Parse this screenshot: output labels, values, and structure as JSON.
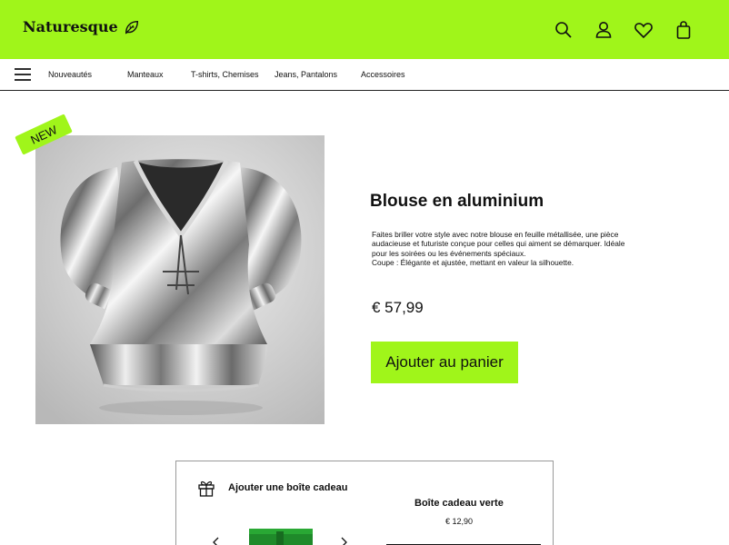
{
  "brand": {
    "name": "Naturesque",
    "logo_icon": "leaf-icon",
    "color": "#a0f51a"
  },
  "header_icons": [
    "search-icon",
    "user-icon",
    "heart-icon",
    "bag-icon"
  ],
  "nav": {
    "menu_icon": "hamburger-menu-icon",
    "items": [
      {
        "label": "Nouveautés"
      },
      {
        "label": "Manteaux"
      },
      {
        "label": "T-shirts, Chemises"
      },
      {
        "label": "Jeans, Pantalons"
      },
      {
        "label": "Accessoires"
      }
    ]
  },
  "product": {
    "badge": "NEW",
    "title": "Blouse en aluminium",
    "description": [
      "Faites briller votre style avec notre blouse en feuille métallisée, une pièce audacieuse et futuriste conçue pour celles qui aiment se démarquer. Idéale pour les soirées ou les événements spéciaux.",
      "Coupe : Élégante et ajustée, mettant en valeur la silhouette."
    ],
    "price": "€ 57,99",
    "cta_label": "Ajouter au panier"
  },
  "gift": {
    "title": "Ajouter une boîte cadeau",
    "icon": "gift-icon",
    "item_name": "Boîte cadeau verte",
    "item_price": "€ 12,90"
  }
}
